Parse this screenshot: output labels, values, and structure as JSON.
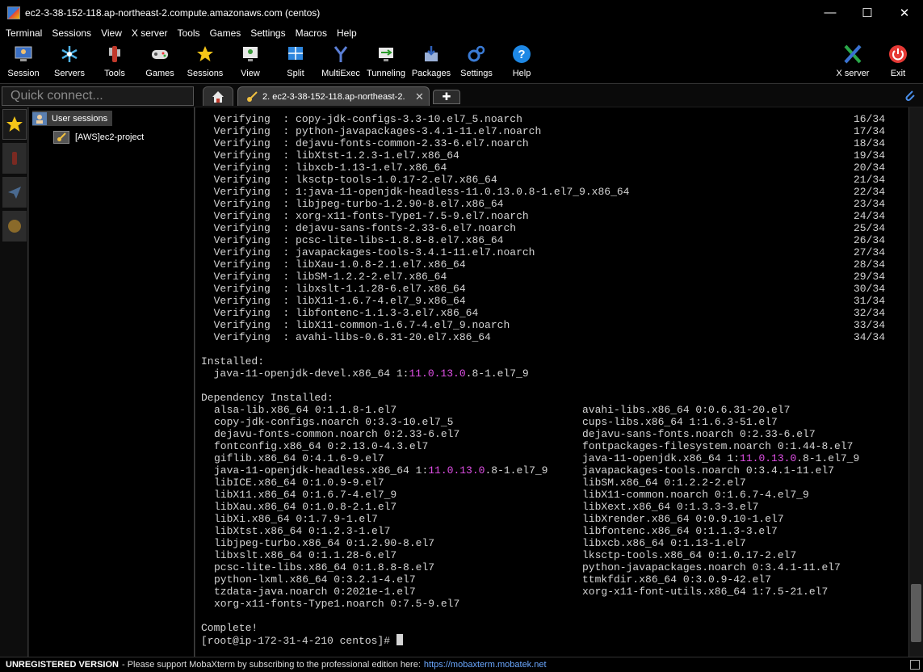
{
  "window": {
    "title": "ec2-3-38-152-118.ap-northeast-2.compute.amazonaws.com (centos)",
    "minimize": "—",
    "maximize": "☐",
    "close": "✕"
  },
  "menu": [
    "Terminal",
    "Sessions",
    "View",
    "X server",
    "Tools",
    "Games",
    "Settings",
    "Macros",
    "Help"
  ],
  "toolbar": {
    "left": [
      {
        "label": "Session",
        "icon": "session-icon"
      },
      {
        "label": "Servers",
        "icon": "servers-icon"
      },
      {
        "label": "Tools",
        "icon": "tools-icon"
      },
      {
        "label": "Games",
        "icon": "games-icon"
      },
      {
        "label": "Sessions",
        "icon": "star-icon"
      },
      {
        "label": "View",
        "icon": "view-icon"
      },
      {
        "label": "Split",
        "icon": "split-icon"
      },
      {
        "label": "MultiExec",
        "icon": "multiexec-icon"
      },
      {
        "label": "Tunneling",
        "icon": "tunneling-icon"
      },
      {
        "label": "Packages",
        "icon": "packages-icon"
      },
      {
        "label": "Settings",
        "icon": "settings-icon"
      },
      {
        "label": "Help",
        "icon": "help-icon"
      }
    ],
    "right": [
      {
        "label": "X server",
        "icon": "x-server-icon"
      },
      {
        "label": "Exit",
        "icon": "power-icon"
      }
    ]
  },
  "quick_connect": {
    "placeholder": "Quick connect..."
  },
  "tabs": {
    "active_label": "2. ec2-3-38-152-118.ap-northeast-2.",
    "close": "✕",
    "new_tab": "✚"
  },
  "sessions_panel": {
    "root_label": "User sessions",
    "child_label": "[AWS]ec2-project"
  },
  "terminal": {
    "verifying": [
      {
        "pkg": "copy-jdk-configs-3.3-10.el7_5.noarch",
        "n": "16/34"
      },
      {
        "pkg": "python-javapackages-3.4.1-11.el7.noarch",
        "n": "17/34"
      },
      {
        "pkg": "dejavu-fonts-common-2.33-6.el7.noarch",
        "n": "18/34"
      },
      {
        "pkg": "libXtst-1.2.3-1.el7.x86_64",
        "n": "19/34"
      },
      {
        "pkg": "libxcb-1.13-1.el7.x86_64",
        "n": "20/34"
      },
      {
        "pkg": "lksctp-tools-1.0.17-2.el7.x86_64",
        "n": "21/34"
      },
      {
        "pkg": "1:java-11-openjdk-headless-11.0.13.0.8-1.el7_9.x86_64",
        "n": "22/34"
      },
      {
        "pkg": "libjpeg-turbo-1.2.90-8.el7.x86_64",
        "n": "23/34"
      },
      {
        "pkg": "xorg-x11-fonts-Type1-7.5-9.el7.noarch",
        "n": "24/34"
      },
      {
        "pkg": "dejavu-sans-fonts-2.33-6.el7.noarch",
        "n": "25/34"
      },
      {
        "pkg": "pcsc-lite-libs-1.8.8-8.el7.x86_64",
        "n": "26/34"
      },
      {
        "pkg": "javapackages-tools-3.4.1-11.el7.noarch",
        "n": "27/34"
      },
      {
        "pkg": "libXau-1.0.8-2.1.el7.x86_64",
        "n": "28/34"
      },
      {
        "pkg": "libSM-1.2.2-2.el7.x86_64",
        "n": "29/34"
      },
      {
        "pkg": "libxslt-1.1.28-6.el7.x86_64",
        "n": "30/34"
      },
      {
        "pkg": "libX11-1.6.7-4.el7_9.x86_64",
        "n": "31/34"
      },
      {
        "pkg": "libfontenc-1.1.3-3.el7.x86_64",
        "n": "32/34"
      },
      {
        "pkg": "libX11-common-1.6.7-4.el7_9.noarch",
        "n": "33/34"
      },
      {
        "pkg": "avahi-libs-0.6.31-20.el7.x86_64",
        "n": "34/34"
      }
    ],
    "verifying_word": "Verifying",
    "installed_header": "Installed:",
    "installed": [
      {
        "pre": "java-11-openjdk-devel.x86_64 1:",
        "hl": "11.0.13.0",
        "post": ".8-1.el7_9"
      }
    ],
    "dependency_header": "Dependency Installed:",
    "dependencies_left": [
      {
        "pre": "alsa-lib.x86_64 0:1.1.8-1.el7",
        "hl": "",
        "post": ""
      },
      {
        "pre": "copy-jdk-configs.noarch 0:3.3-10.el7_5",
        "hl": "",
        "post": ""
      },
      {
        "pre": "dejavu-fonts-common.noarch 0:2.33-6.el7",
        "hl": "",
        "post": ""
      },
      {
        "pre": "fontconfig.x86_64 0:2.13.0-4.3.el7",
        "hl": "",
        "post": ""
      },
      {
        "pre": "giflib.x86_64 0:4.1.6-9.el7",
        "hl": "",
        "post": ""
      },
      {
        "pre": "java-11-openjdk-headless.x86_64 1:",
        "hl": "11.0.13.0",
        "post": ".8-1.el7_9"
      },
      {
        "pre": "libICE.x86_64 0:1.0.9-9.el7",
        "hl": "",
        "post": ""
      },
      {
        "pre": "libX11.x86_64 0:1.6.7-4.el7_9",
        "hl": "",
        "post": ""
      },
      {
        "pre": "libXau.x86_64 0:1.0.8-2.1.el7",
        "hl": "",
        "post": ""
      },
      {
        "pre": "libXi.x86_64 0:1.7.9-1.el7",
        "hl": "",
        "post": ""
      },
      {
        "pre": "libXtst.x86_64 0:1.2.3-1.el7",
        "hl": "",
        "post": ""
      },
      {
        "pre": "libjpeg-turbo.x86_64 0:1.2.90-8.el7",
        "hl": "",
        "post": ""
      },
      {
        "pre": "libxslt.x86_64 0:1.1.28-6.el7",
        "hl": "",
        "post": ""
      },
      {
        "pre": "pcsc-lite-libs.x86_64 0:1.8.8-8.el7",
        "hl": "",
        "post": ""
      },
      {
        "pre": "python-lxml.x86_64 0:3.2.1-4.el7",
        "hl": "",
        "post": ""
      },
      {
        "pre": "tzdata-java.noarch 0:2021e-1.el7",
        "hl": "",
        "post": ""
      },
      {
        "pre": "xorg-x11-fonts-Type1.noarch 0:7.5-9.el7",
        "hl": "",
        "post": ""
      }
    ],
    "dependencies_right": [
      {
        "pre": "avahi-libs.x86_64 0:0.6.31-20.el7",
        "hl": "",
        "post": ""
      },
      {
        "pre": "cups-libs.x86_64 1:1.6.3-51.el7",
        "hl": "",
        "post": ""
      },
      {
        "pre": "dejavu-sans-fonts.noarch 0:2.33-6.el7",
        "hl": "",
        "post": ""
      },
      {
        "pre": "fontpackages-filesystem.noarch 0:1.44-8.el7",
        "hl": "",
        "post": ""
      },
      {
        "pre": "java-11-openjdk.x86_64 1:",
        "hl": "11.0.13.0",
        "post": ".8-1.el7_9"
      },
      {
        "pre": "javapackages-tools.noarch 0:3.4.1-11.el7",
        "hl": "",
        "post": ""
      },
      {
        "pre": "libSM.x86_64 0:1.2.2-2.el7",
        "hl": "",
        "post": ""
      },
      {
        "pre": "libX11-common.noarch 0:1.6.7-4.el7_9",
        "hl": "",
        "post": ""
      },
      {
        "pre": "libXext.x86_64 0:1.3.3-3.el7",
        "hl": "",
        "post": ""
      },
      {
        "pre": "libXrender.x86_64 0:0.9.10-1.el7",
        "hl": "",
        "post": ""
      },
      {
        "pre": "libfontenc.x86_64 0:1.1.3-3.el7",
        "hl": "",
        "post": ""
      },
      {
        "pre": "libxcb.x86_64 0:1.13-1.el7",
        "hl": "",
        "post": ""
      },
      {
        "pre": "lksctp-tools.x86_64 0:1.0.17-2.el7",
        "hl": "",
        "post": ""
      },
      {
        "pre": "python-javapackages.noarch 0:3.4.1-11.el7",
        "hl": "",
        "post": ""
      },
      {
        "pre": "ttmkfdir.x86_64 0:3.0.9-42.el7",
        "hl": "",
        "post": ""
      },
      {
        "pre": "xorg-x11-font-utils.x86_64 1:7.5-21.el7",
        "hl": "",
        "post": ""
      }
    ],
    "complete": "Complete!",
    "prompt": "[root@ip-172-31-4-210 centos]# "
  },
  "status": {
    "unregistered": "UNREGISTERED VERSION",
    "message": "-  Please support MobaXterm by subscribing to the professional edition here:",
    "link": "https://mobaxterm.mobatek.net"
  },
  "colors": {
    "highlight": "#e04fe6",
    "link": "#6aa7ff"
  }
}
